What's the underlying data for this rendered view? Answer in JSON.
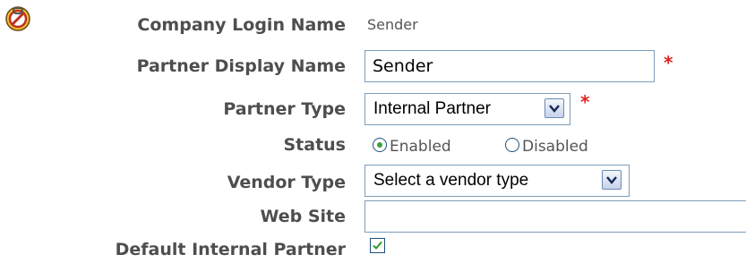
{
  "form": {
    "company_login_name": {
      "label": "Company Login Name",
      "value": "Sender"
    },
    "partner_display_name": {
      "label": "Partner Display Name",
      "value": "Sender",
      "required_marker": "*"
    },
    "partner_type": {
      "label": "Partner Type",
      "selected": "Internal Partner",
      "required_marker": "*"
    },
    "status": {
      "label": "Status",
      "options": [
        "Enabled",
        "Disabled"
      ],
      "selected": "Enabled"
    },
    "vendor_type": {
      "label": "Vendor Type",
      "selected": "Select a vendor type"
    },
    "web_site": {
      "label": "Web Site",
      "value": ""
    },
    "default_internal_partner": {
      "label": "Default Internal Partner",
      "checked": true
    }
  },
  "icons": {
    "top_left": "lock-icon",
    "dropdown": "chevron-down-icon",
    "checkbox": "checkmark-icon"
  },
  "colors": {
    "label": "#4e4e4e",
    "required": "#e02020",
    "radio_selected": "#3aa336",
    "checkmark": "#2e9a2e",
    "control_border": "#7f9db9"
  }
}
